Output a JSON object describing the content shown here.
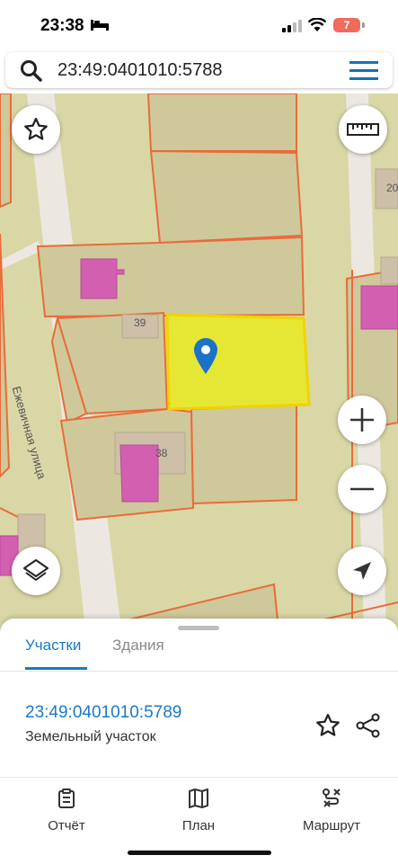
{
  "status_bar": {
    "time": "23:38",
    "battery": "7"
  },
  "search": {
    "query": "23:49:0401010:5788"
  },
  "map": {
    "street_name": "Ежевичная улица",
    "house_numbers": [
      "39",
      "38",
      "20"
    ],
    "colors": {
      "ground": "#d9d7a6",
      "parcel_border": "#ea6b3a",
      "selected_fill": "#e6e634",
      "selected_border": "#f0d400",
      "building": "#d35fb1",
      "marker": "#1a73c9"
    }
  },
  "bottom_sheet": {
    "tabs": [
      "Участки",
      "Здания"
    ],
    "active_tab": "Участки",
    "parcel": {
      "cadastral_number": "23:49:0401010:5789",
      "type": "Земельный участок"
    }
  },
  "bottom_nav": {
    "items": [
      {
        "label": "Отчёт",
        "icon": "report-icon"
      },
      {
        "label": "План",
        "icon": "map-book-icon"
      },
      {
        "label": "Маршрут",
        "icon": "route-icon"
      }
    ]
  }
}
